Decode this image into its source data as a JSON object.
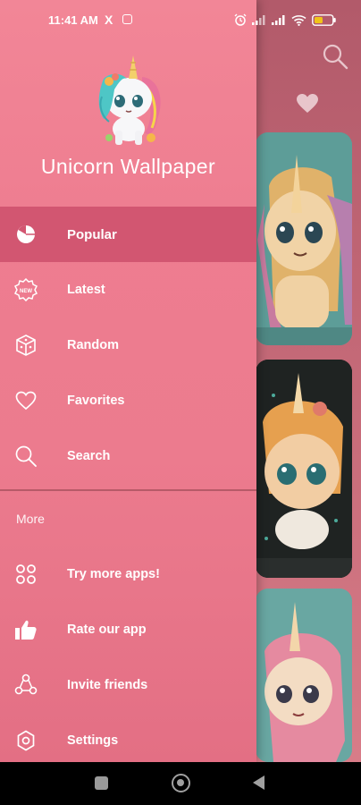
{
  "status_bar": {
    "time": "11:41 AM",
    "x_icon": "X",
    "icons": [
      "alarm-icon",
      "signal-icon",
      "signal-icon",
      "wifi-icon",
      "battery-icon"
    ],
    "battery_color": "#f0c419"
  },
  "drawer": {
    "app_title": "Unicorn Wallpaper",
    "menu": [
      {
        "label": "Popular",
        "icon": "pie-chart-icon",
        "active": true
      },
      {
        "label": "Latest",
        "icon": "new-badge-icon",
        "active": false
      },
      {
        "label": "Random",
        "icon": "dice-icon",
        "active": false
      },
      {
        "label": "Favorites",
        "icon": "heart-icon",
        "active": false
      },
      {
        "label": "Search",
        "icon": "search-icon",
        "active": false
      }
    ],
    "section_more": "More",
    "more_menu": [
      {
        "label": "Try more apps!",
        "icon": "apps-grid-icon"
      },
      {
        "label": "Rate our app",
        "icon": "thumbs-up-icon"
      },
      {
        "label": "Invite friends",
        "icon": "share-icon"
      },
      {
        "label": "Settings",
        "icon": "settings-gear-icon"
      }
    ]
  },
  "colors": {
    "drawer_bg": "#ee7d90",
    "active_item_bg": "#d25671",
    "background_app": "#c56a78"
  },
  "nav_bar": {
    "buttons": [
      "recents-button",
      "home-button",
      "back-button"
    ]
  }
}
